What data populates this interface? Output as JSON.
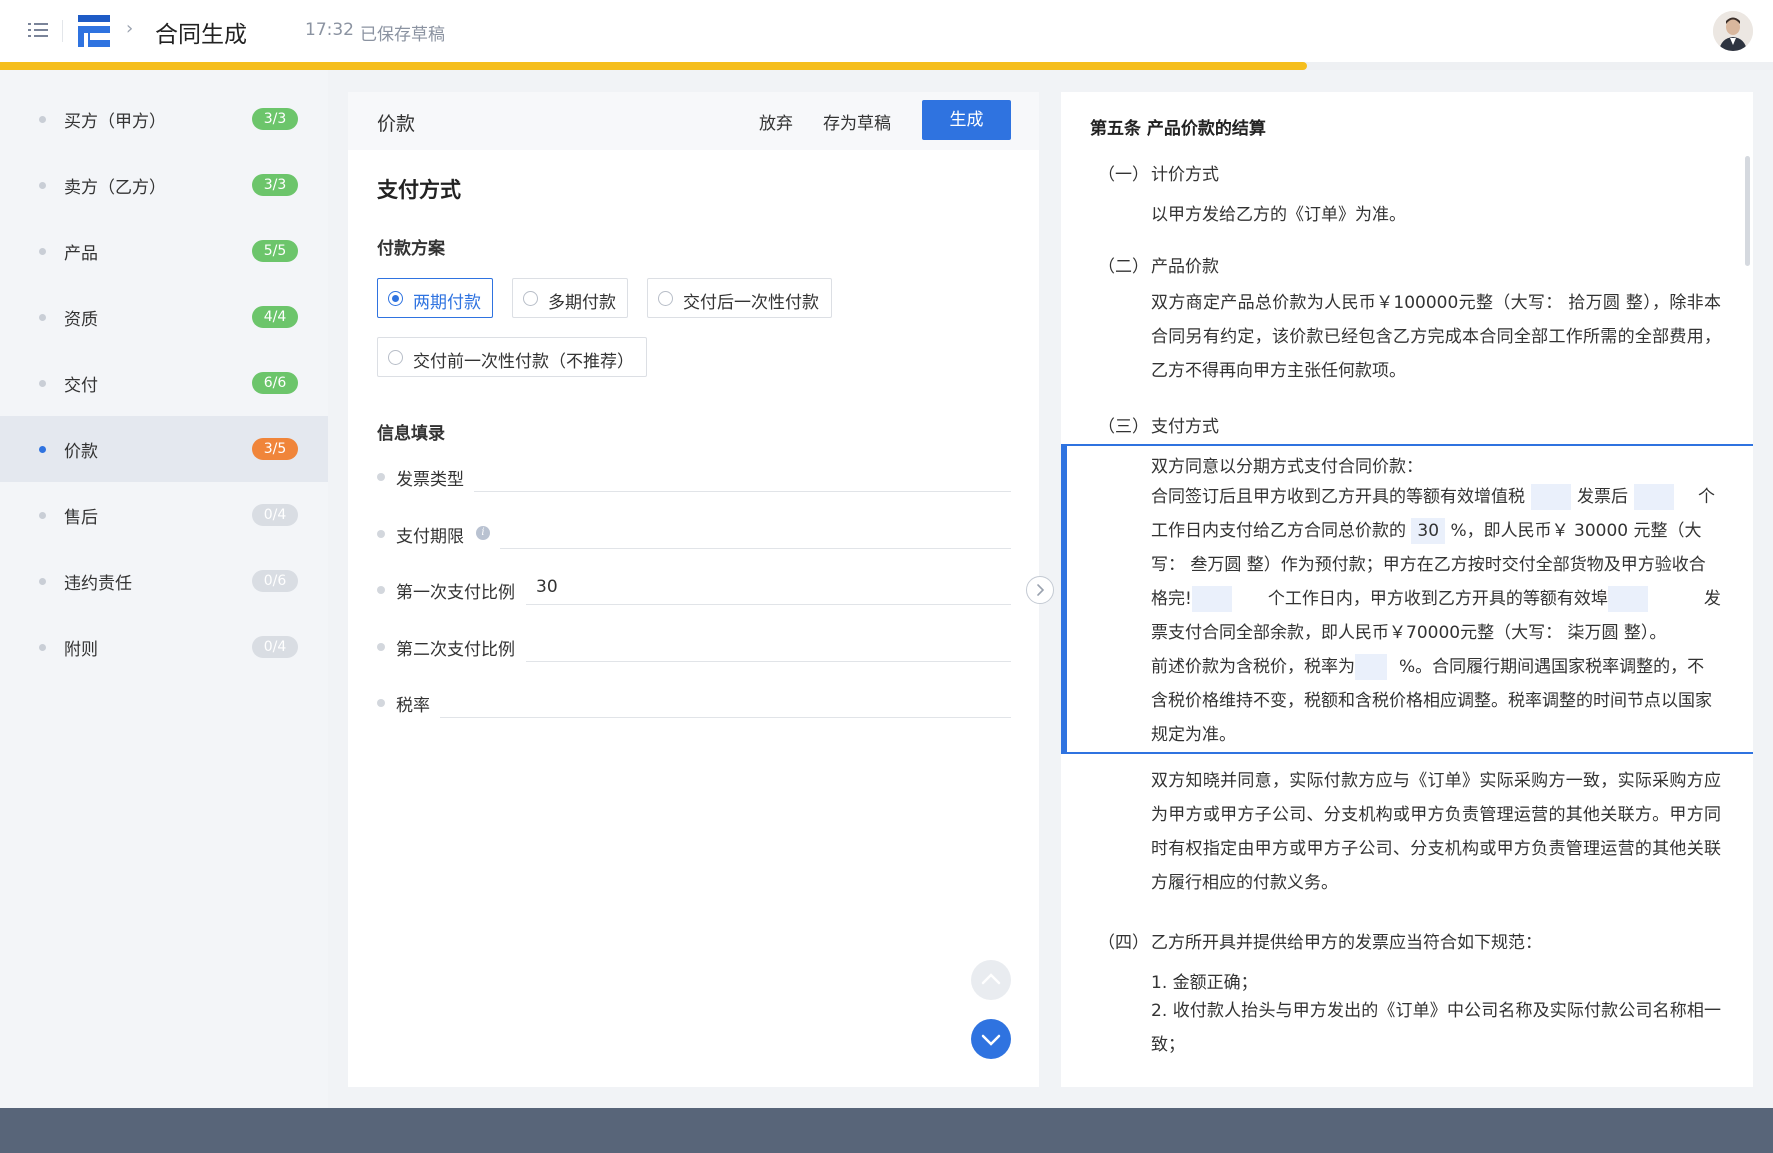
{
  "header": {
    "title": "合同生成",
    "save_time": "17:32",
    "save_status": "已保存草稿",
    "progress_fraction": 0.737
  },
  "sidebar": {
    "items": [
      {
        "label": "买方（甲方）",
        "badge": "3/3",
        "state": "done"
      },
      {
        "label": "卖方（乙方）",
        "badge": "3/3",
        "state": "done"
      },
      {
        "label": "产品",
        "badge": "5/5",
        "state": "done"
      },
      {
        "label": "资质",
        "badge": "4/4",
        "state": "done"
      },
      {
        "label": "交付",
        "badge": "6/6",
        "state": "done"
      },
      {
        "label": "价款",
        "badge": "3/5",
        "state": "active"
      },
      {
        "label": "售后",
        "badge": "0/4",
        "state": "empty"
      },
      {
        "label": "违约责任",
        "badge": "0/6",
        "state": "empty"
      },
      {
        "label": "附则",
        "badge": "0/4",
        "state": "empty"
      }
    ]
  },
  "form": {
    "header_title": "价款",
    "discard_label": "放弃",
    "save_draft_label": "存为草稿",
    "generate_label": "生成",
    "section_title": "支付方式",
    "payment_plan_title": "付款方案",
    "payment_options": [
      "两期付款",
      "多期付款",
      "交付后一次性付款",
      "交付前一次性付款（不推荐）"
    ],
    "selected_option": "两期付款",
    "info_title": "信息填录",
    "fields": [
      {
        "label": "发票类型",
        "value": ""
      },
      {
        "label": "支付期限",
        "value": ""
      },
      {
        "label": "第一次支付比例",
        "value": "30"
      },
      {
        "label": "第二次支付比例",
        "value": ""
      },
      {
        "label": "税率",
        "value": ""
      }
    ]
  },
  "preview": {
    "heading": "第五条  产品价款的结算",
    "s1_num": "（一）",
    "s1_title": "计价方式",
    "s1_text": "以甲方发给乙方的《订单》为准。",
    "s2_num": "（二）",
    "s2_title": "产品价款",
    "s2_text": "双方商定产品总价款为人民币￥100000元整（大写：  拾万圆  整），除非本合同另有约定，该价款已经包含乙方完成本合同全部工作所需的全部费用，乙方不得再向甲方主张任何款项。",
    "s3_num": "（三）",
    "s3_title": "支付方式",
    "s3_l1": "双方同意以分期方式支付合同价款：",
    "s3_l2a": "合同签订后且甲方收到乙方开具的等额有效增值税",
    "s3_l2b": "发票后",
    "s3_l2c": "个",
    "s3_l3a": "工作日内支付给乙方合同总价款的",
    "s3_l3b": "30",
    "s3_l3c": "%，即人民币￥ 30000  元整（大",
    "s3_l4": "写：   叁万圆  整）作为预付款；甲方在乙方按时交付全部货物及甲方验收合",
    "s3_l5a": "格完!",
    "s3_l5b": "个工作日内，甲方收到乙方开具的等额有效埠",
    "s3_l5c": "发",
    "s3_l6": "票支付合同全部余款，即人民币￥70000元整（大写：  柒万圆   整）。",
    "s3_l7a": "前述价款为含税价，税率为",
    "s3_l7b": "%。合同履行期间遇国家税率调整的，不",
    "s3_l8": "含税价格维持不变，税额和含税价格相应调整。税率调整的时间节点以国家",
    "s3_l9": "规定为准。",
    "s3_after": "双方知晓并同意，实际付款方应与《订单》实际采购方一致，实际采购方应为甲方或甲方子公司、分支机构或甲方负责管理运营的其他关联方。甲方同时有权指定由甲方或甲方子公司、分支机构或甲方负责管理运营的其他关联方履行相应的付款义务。",
    "s4_num": "（四）",
    "s4_title": "乙方所开具并提供给甲方的发票应当符合如下规范：",
    "s4_item1": "1. 金额正确；",
    "s4_item2": "2. 收付款人抬头与甲方发出的《订单》中公司名称及实际付款公司名称相一致；"
  },
  "colors": {
    "accent": "#2f73e0",
    "progress": "#f5be1d",
    "badge_done": "#6cc56b",
    "badge_active": "#f0853a",
    "footer": "#586579"
  }
}
